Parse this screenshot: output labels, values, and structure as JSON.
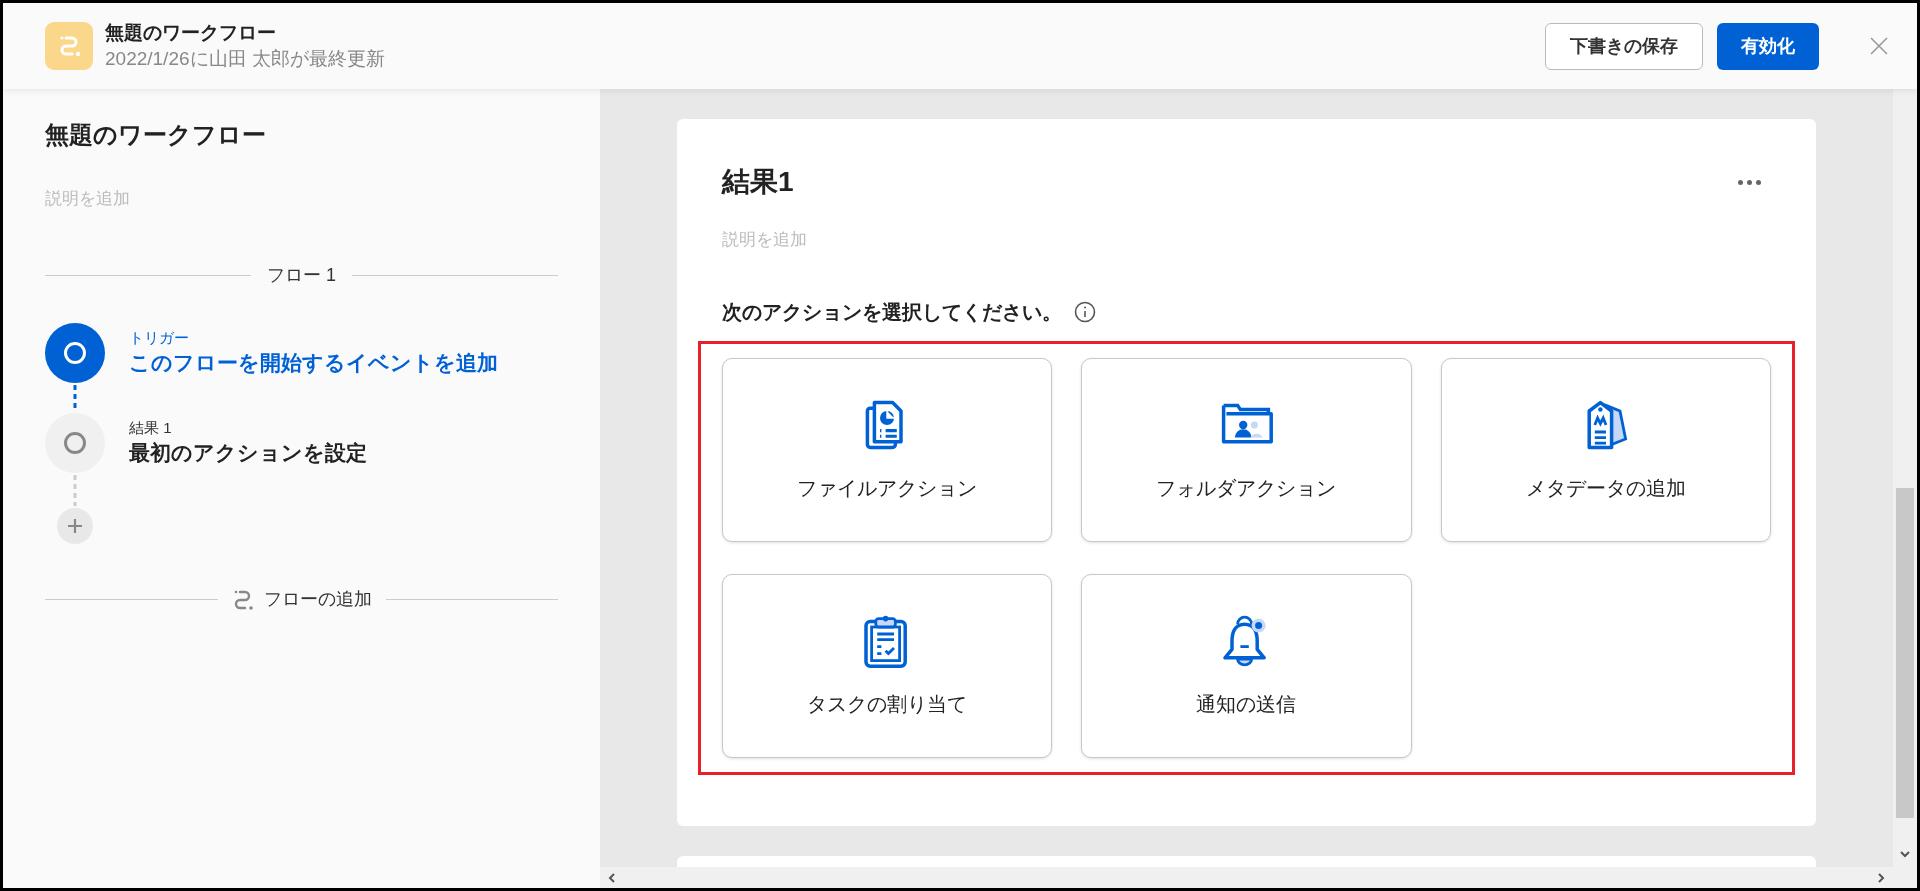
{
  "header": {
    "title": "無題のワークフロー",
    "subtitle": "2022/1/26に山田 太郎が最終更新",
    "buttons": [
      {
        "label": "下書きの保存",
        "kind": "secondary"
      },
      {
        "label": "有効化",
        "kind": "primary"
      }
    ]
  },
  "sidebar": {
    "title": "無題のワークフロー",
    "placeholder": "説明を追加",
    "flow_label": "フロー 1",
    "steps": [
      {
        "label": "トリガー",
        "title": "このフローを開始するイベントを追加",
        "active": true
      },
      {
        "label": "結果 1",
        "title": "最初のアクションを設定",
        "active": false
      }
    ],
    "add_flow": "フローの追加"
  },
  "card": {
    "title": "結果1",
    "placeholder": "説明を追加",
    "prompt": "次のアクションを選択してください。",
    "actions": [
      {
        "label": "ファイルアクション",
        "kind": "file"
      },
      {
        "label": "フォルダアクション",
        "kind": "folder"
      },
      {
        "label": "メタデータの追加",
        "kind": "metadata"
      },
      {
        "label": "タスクの割り当て",
        "kind": "task"
      },
      {
        "label": "通知の送信",
        "kind": "notification"
      }
    ]
  }
}
